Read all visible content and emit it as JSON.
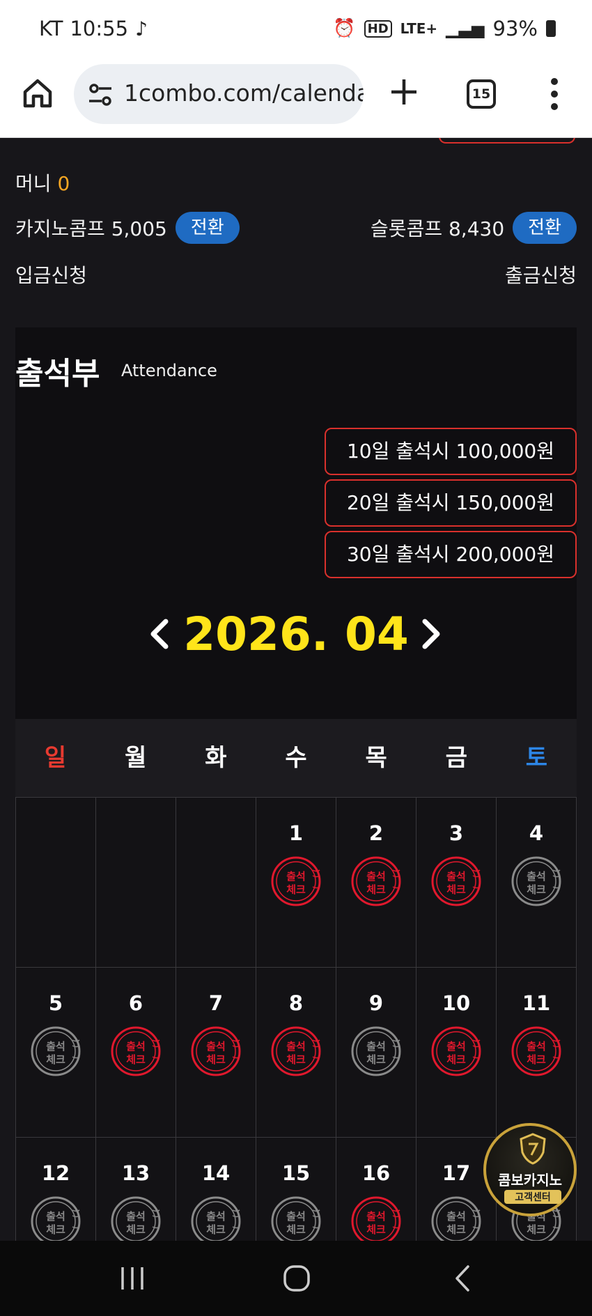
{
  "status_bar": {
    "carrier": "KT",
    "time": "10:55",
    "network": "LTE+",
    "battery": "93%"
  },
  "browser": {
    "url": "1combo.com/calenda",
    "tab_count": "15"
  },
  "account": {
    "money_label": "머니",
    "money_value": "0",
    "casino_comp": "카지노콤프 5,005",
    "slot_comp": "슬롯콤프 8,430",
    "convert_label": "전환",
    "deposit": "입금신청",
    "withdraw": "출금신청"
  },
  "attendance": {
    "title": "출석부",
    "subtitle": "Attendance",
    "bonuses": [
      "10일 출석시 100,000원",
      "20일 출석시 150,000원",
      "30일 출석시 200,000원"
    ],
    "month": "2026. 04"
  },
  "weekdays": [
    "일",
    "월",
    "화",
    "수",
    "목",
    "금",
    "토"
  ],
  "calendar": [
    {
      "day": "",
      "stamp": "none"
    },
    {
      "day": "",
      "stamp": "none"
    },
    {
      "day": "",
      "stamp": "none"
    },
    {
      "day": "1",
      "stamp": "checked"
    },
    {
      "day": "2",
      "stamp": "checked"
    },
    {
      "day": "3",
      "stamp": "checked"
    },
    {
      "day": "4",
      "stamp": "missed"
    },
    {
      "day": "5",
      "stamp": "missed"
    },
    {
      "day": "6",
      "stamp": "checked"
    },
    {
      "day": "7",
      "stamp": "checked"
    },
    {
      "day": "8",
      "stamp": "checked"
    },
    {
      "day": "9",
      "stamp": "missed"
    },
    {
      "day": "10",
      "stamp": "checked"
    },
    {
      "day": "11",
      "stamp": "checked"
    },
    {
      "day": "12",
      "stamp": "missed"
    },
    {
      "day": "13",
      "stamp": "missed"
    },
    {
      "day": "14",
      "stamp": "missed"
    },
    {
      "day": "15",
      "stamp": "missed"
    },
    {
      "day": "16",
      "stamp": "checked"
    },
    {
      "day": "17",
      "stamp": "missed"
    },
    {
      "day": "",
      "stamp": "missed"
    }
  ],
  "stamp_text": [
    "출석",
    "체크"
  ],
  "stamp_colors": {
    "checked": "#e0182d",
    "missed": "#8a8a8a"
  },
  "cs_badge": {
    "title": "콤보카지노",
    "subtitle": "고객센터"
  }
}
